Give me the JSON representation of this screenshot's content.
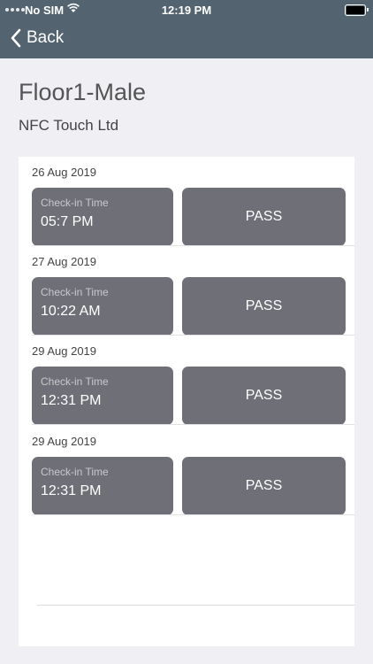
{
  "status_bar": {
    "carrier": "No SIM",
    "time": "12:19 PM"
  },
  "nav": {
    "back_label": "Back"
  },
  "header": {
    "title": "Floor1-Male",
    "subtitle": "NFC Touch Ltd"
  },
  "records": [
    {
      "date": "26 Aug 2019",
      "checkin_label": "Check-in Time",
      "checkin_time": "05:7 PM",
      "status": "PASS"
    },
    {
      "date": "27 Aug 2019",
      "checkin_label": "Check-in Time",
      "checkin_time": "10:22 AM",
      "status": "PASS"
    },
    {
      "date": "29 Aug 2019",
      "checkin_label": "Check-in Time",
      "checkin_time": "12:31 PM",
      "status": "PASS"
    },
    {
      "date": "29 Aug 2019",
      "checkin_label": "Check-in Time",
      "checkin_time": "12:31 PM",
      "status": "PASS"
    }
  ],
  "colors": {
    "nav_bar": "#536470",
    "card": "#6f7077",
    "background": "#efeff4"
  }
}
